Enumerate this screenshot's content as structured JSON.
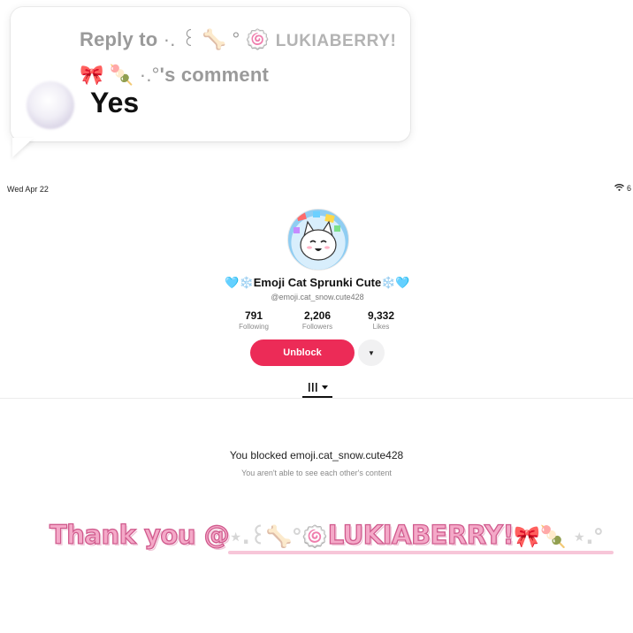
{
  "reply": {
    "prefix": "Reply to ",
    "deco_1": "·. ꒰ 🦴 ° 🍥 ",
    "username": "LUKIABERRY!",
    "deco_2": "🎀 🍡 ·.°",
    "suffix": "'s comment",
    "text": "Yes"
  },
  "status_bar": {
    "date": "Wed Apr 22",
    "wifi_icon": "wifi-icon",
    "battery": "6"
  },
  "profile": {
    "name_left_deco": "🩵❄️",
    "display_name": "Emoji Cat Sprunki Cute",
    "name_right_deco": "❄️🩵",
    "handle": "@emoji.cat_snow.cute428",
    "stats": {
      "following": {
        "value": "791",
        "label": "Following"
      },
      "followers": {
        "value": "2,206",
        "label": "Followers"
      },
      "likes": {
        "value": "9,332",
        "label": "Likes"
      }
    },
    "unblock_label": "Unblock",
    "more_icon": "▼",
    "tab_icon": "grid-icon",
    "blocked_title": "You blocked emoji.cat_snow.cute428",
    "blocked_sub": "You aren't able to see each other's content"
  },
  "caption": {
    "lead": "Thank you @",
    "deco": "⋆.꒰🦴°🍥",
    "username": "LUKIABERRY!",
    "tail": "🎀🍡 ⋆.°"
  },
  "colors": {
    "unblock_bg": "#ec2b57",
    "caption_fill": "#f4a9c8",
    "caption_outline": "#d05a8d"
  }
}
